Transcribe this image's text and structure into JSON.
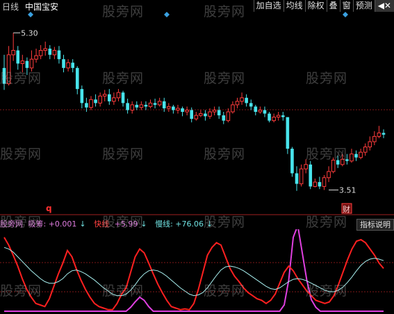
{
  "header": {
    "period": "日线",
    "stock_name": "中国宝安",
    "toolbar": [
      {
        "label": "加自选",
        "name": "add-watchlist-button"
      },
      {
        "label": "均线",
        "name": "moving-average-button"
      },
      {
        "label": "除权",
        "name": "ex-rights-button"
      },
      {
        "label": "叠",
        "name": "overlay-button"
      },
      {
        "label": "窗",
        "name": "window-button"
      },
      {
        "label": "预测",
        "name": "forecast-button"
      },
      {
        "label": "◀✕",
        "name": "close-button"
      }
    ]
  },
  "price_panel": {
    "high_label": "5.30",
    "low_label": "3.51",
    "marker_q": "q",
    "badge_cai": "财",
    "colors": {
      "up": "#ff3c3c",
      "down": "#48e4ec",
      "marker": "#3aa0e0",
      "grid": "#801818"
    }
  },
  "indicator_panel": {
    "name": "股旁网",
    "pair_label": "吸筹: +0.001",
    "pair_arrow": "↓",
    "fast_label": "快线",
    "fast_value": "+5.99",
    "fast_arrow": "↓",
    "slow_label": "慢线: +76.06",
    "slow_arrow": "↓",
    "button_label": "指标说明",
    "colors": {
      "fast": "#ff2020",
      "slow": "#a8f0f0",
      "accum": "#e040e0"
    }
  },
  "watermark": "股旁网",
  "chart_data": [
    {
      "type": "candlestick",
      "title": "中国宝安 日线",
      "ylim": [
        3.3,
        5.5
      ],
      "annotations": [
        {
          "text": "5.30",
          "bar": 2,
          "value": 5.3
        },
        {
          "text": "3.51",
          "bar": 71,
          "value": 3.51
        }
      ],
      "candles": [
        [
          4.9,
          4.72,
          5.05,
          4.65
        ],
        [
          4.72,
          5.05,
          5.15,
          4.7
        ],
        [
          5.05,
          5.1,
          5.3,
          4.98
        ],
        [
          5.1,
          4.95,
          5.15,
          4.88
        ],
        [
          4.95,
          4.98,
          5.05,
          4.85
        ],
        [
          4.98,
          4.9,
          5.02,
          4.82
        ],
        [
          4.9,
          5.0,
          5.1,
          4.86
        ],
        [
          5.0,
          5.04,
          5.12,
          4.96
        ],
        [
          5.04,
          5.1,
          5.16,
          5.0
        ],
        [
          5.1,
          5.12,
          5.2,
          5.04
        ],
        [
          5.12,
          5.05,
          5.16,
          5.0
        ],
        [
          5.05,
          5.1,
          5.14,
          5.0
        ],
        [
          5.1,
          5.0,
          5.15,
          4.95
        ],
        [
          5.0,
          4.9,
          5.05,
          4.85
        ],
        [
          4.9,
          4.96,
          5.0,
          4.86
        ],
        [
          4.96,
          4.9,
          5.0,
          4.85
        ],
        [
          4.9,
          4.66,
          4.92,
          4.6
        ],
        [
          4.66,
          4.5,
          4.7,
          4.44
        ],
        [
          4.5,
          4.45,
          4.56,
          4.4
        ],
        [
          4.45,
          4.54,
          4.58,
          4.42
        ],
        [
          4.54,
          4.5,
          4.6,
          4.46
        ],
        [
          4.5,
          4.58,
          4.62,
          4.46
        ],
        [
          4.58,
          4.6,
          4.65,
          4.52
        ],
        [
          4.6,
          4.52,
          4.66,
          4.48
        ],
        [
          4.52,
          4.56,
          4.62,
          4.48
        ],
        [
          4.56,
          4.62,
          4.66,
          4.52
        ],
        [
          4.62,
          4.5,
          4.64,
          4.46
        ],
        [
          4.5,
          4.42,
          4.55,
          4.38
        ],
        [
          4.42,
          4.48,
          4.52,
          4.38
        ],
        [
          4.48,
          4.45,
          4.52,
          4.42
        ],
        [
          4.45,
          4.48,
          4.52,
          4.42
        ],
        [
          4.48,
          4.46,
          4.52,
          4.42
        ],
        [
          4.46,
          4.5,
          4.54,
          4.44
        ],
        [
          4.5,
          4.48,
          4.55,
          4.44
        ],
        [
          4.48,
          4.52,
          4.56,
          4.46
        ],
        [
          4.52,
          4.44,
          4.56,
          4.4
        ],
        [
          4.44,
          4.46,
          4.5,
          4.4
        ],
        [
          4.46,
          4.42,
          4.48,
          4.38
        ],
        [
          4.42,
          4.44,
          4.48,
          4.38
        ],
        [
          4.44,
          4.4,
          4.46,
          4.35
        ],
        [
          4.4,
          4.42,
          4.46,
          4.36
        ],
        [
          4.42,
          4.32,
          4.45,
          4.28
        ],
        [
          4.32,
          4.36,
          4.4,
          4.3
        ],
        [
          4.36,
          4.38,
          4.42,
          4.34
        ],
        [
          4.38,
          4.35,
          4.42,
          4.3
        ],
        [
          4.35,
          4.4,
          4.44,
          4.32
        ],
        [
          4.4,
          4.42,
          4.46,
          4.36
        ],
        [
          4.42,
          4.36,
          4.46,
          4.32
        ],
        [
          4.36,
          4.3,
          4.4,
          4.26
        ],
        [
          4.3,
          4.4,
          4.44,
          4.28
        ],
        [
          4.4,
          4.48,
          4.52,
          4.38
        ],
        [
          4.48,
          4.52,
          4.56,
          4.44
        ],
        [
          4.52,
          4.56,
          4.62,
          4.48
        ],
        [
          4.56,
          4.5,
          4.6,
          4.46
        ],
        [
          4.5,
          4.46,
          4.54,
          4.42
        ],
        [
          4.46,
          4.4,
          4.48,
          4.36
        ],
        [
          4.4,
          4.42,
          4.46,
          4.38
        ],
        [
          4.42,
          4.38,
          4.46,
          4.34
        ],
        [
          4.38,
          4.3,
          4.4,
          4.28
        ],
        [
          4.3,
          4.34,
          4.38,
          4.28
        ],
        [
          4.34,
          4.36,
          4.4,
          4.3
        ],
        [
          4.36,
          4.34,
          4.4,
          4.3
        ],
        [
          4.34,
          3.98,
          4.0,
          3.92
        ],
        [
          3.98,
          3.7,
          4.0,
          3.66
        ],
        [
          3.7,
          3.58,
          3.78,
          3.5
        ],
        [
          3.58,
          3.75,
          3.8,
          3.55
        ],
        [
          3.75,
          3.8,
          3.86,
          3.7
        ],
        [
          3.8,
          3.55,
          3.84,
          3.52
        ],
        [
          3.55,
          3.6,
          3.64,
          3.54
        ],
        [
          3.6,
          3.55,
          3.66,
          3.52
        ],
        [
          3.55,
          3.65,
          3.68,
          3.51
        ],
        [
          3.65,
          3.72,
          3.78,
          3.6
        ],
        [
          3.72,
          3.85,
          3.88,
          3.7
        ],
        [
          3.85,
          3.8,
          3.9,
          3.76
        ],
        [
          3.8,
          3.86,
          3.92,
          3.78
        ],
        [
          3.86,
          3.84,
          3.92,
          3.8
        ],
        [
          3.84,
          3.92,
          3.98,
          3.82
        ],
        [
          3.92,
          3.88,
          3.96,
          3.84
        ],
        [
          3.88,
          3.94,
          3.98,
          3.86
        ],
        [
          3.94,
          4.0,
          4.04,
          3.9
        ],
        [
          4.0,
          4.06,
          4.12,
          3.96
        ],
        [
          4.06,
          4.12,
          4.18,
          4.02
        ],
        [
          4.12,
          4.16,
          4.24,
          4.1
        ],
        [
          4.16,
          4.14,
          4.2,
          4.1
        ]
      ]
    },
    {
      "type": "line",
      "title": "",
      "ylim": [
        0,
        100
      ],
      "series": [
        {
          "name": "快线",
          "values": [
            95,
            85,
            72,
            58,
            42,
            28,
            18,
            10,
            8,
            6,
            16,
            32,
            48,
            62,
            78,
            70,
            54,
            40,
            28,
            18,
            10,
            6,
            4,
            2,
            2,
            10,
            22,
            30,
            50,
            70,
            80,
            75,
            62,
            48,
            35,
            24,
            14,
            6,
            4,
            2,
            3,
            2,
            10,
            28,
            50,
            72,
            82,
            88,
            85,
            70,
            55,
            45,
            38,
            30,
            24,
            20,
            16,
            14,
            10,
            14,
            22,
            36,
            50,
            58,
            52,
            42,
            34,
            26,
            20,
            14,
            12,
            10,
            12,
            20,
            34,
            50,
            66,
            80,
            90,
            92,
            88,
            80,
            72,
            62,
            55
          ]
        },
        {
          "name": "慢线",
          "values": [
            82,
            80,
            76,
            70,
            64,
            58,
            52,
            47,
            42,
            38,
            36,
            36,
            38,
            42,
            48,
            52,
            53,
            51,
            48,
            44,
            40,
            35,
            30,
            26,
            22,
            20,
            20,
            22,
            27,
            34,
            42,
            48,
            52,
            53,
            52,
            49,
            45,
            40,
            35,
            30,
            26,
            22,
            20,
            21,
            24,
            30,
            38,
            46,
            53,
            57,
            58,
            57,
            55,
            52,
            48,
            44,
            40,
            36,
            32,
            29,
            28,
            30,
            34,
            38,
            41,
            42,
            41,
            39,
            36,
            33,
            30,
            27,
            25,
            25,
            27,
            31,
            37,
            44,
            52,
            59,
            64,
            67,
            68,
            67,
            65
          ]
        },
        {
          "name": "吸筹",
          "values": [
            0,
            0,
            0,
            0,
            0,
            0,
            0,
            0,
            0,
            0,
            0,
            0,
            0,
            0,
            0,
            0,
            0,
            0,
            0,
            0,
            0,
            0,
            0,
            0,
            0,
            0,
            0,
            0,
            5,
            12,
            18,
            14,
            6,
            0,
            0,
            0,
            0,
            0,
            0,
            0,
            0,
            0,
            0,
            0,
            0,
            0,
            0,
            0,
            0,
            0,
            0,
            0,
            0,
            0,
            0,
            0,
            0,
            0,
            0,
            0,
            0,
            0,
            8,
            40,
            95,
            110,
            75,
            40,
            15,
            5,
            0,
            0,
            0,
            0,
            0,
            0,
            0,
            0,
            0,
            0,
            0,
            0,
            0,
            0,
            0
          ]
        }
      ]
    }
  ]
}
